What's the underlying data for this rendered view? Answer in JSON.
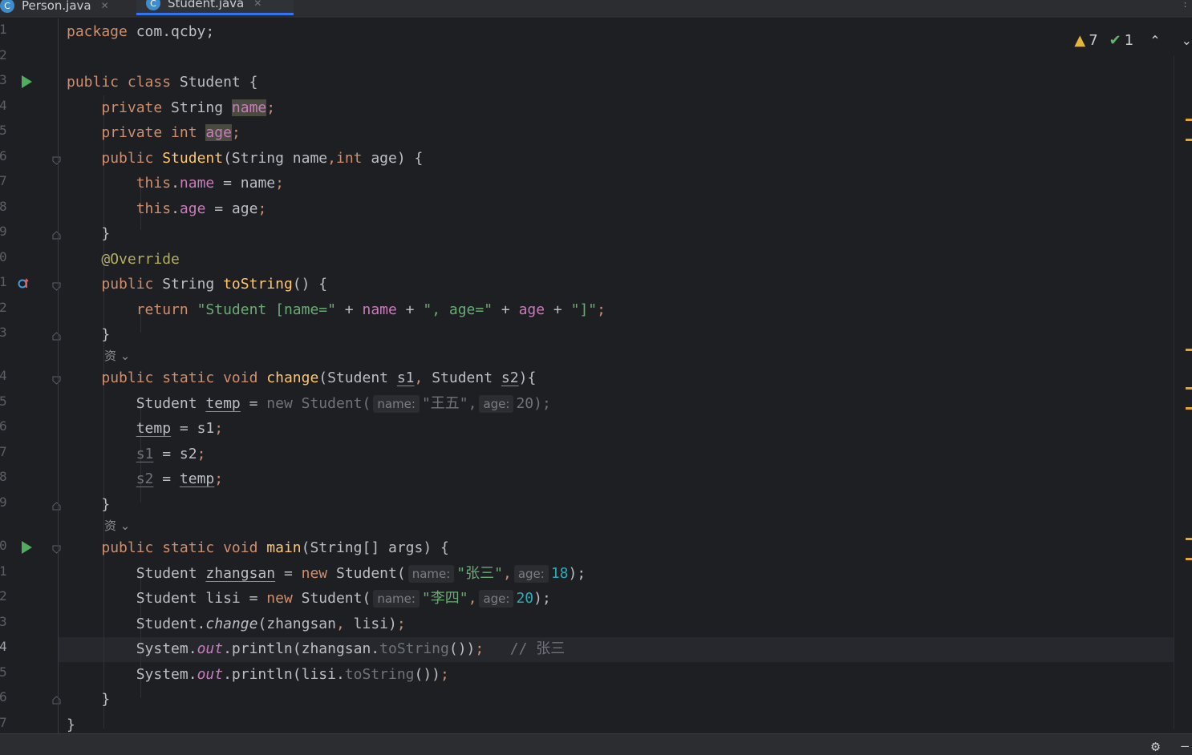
{
  "tabs": [
    {
      "label": "Person.java",
      "icon": "C"
    },
    {
      "label": "Student.java",
      "icon": "C"
    }
  ],
  "inspection": {
    "warnings": "7",
    "ok": "1"
  },
  "line_numbers": [
    "1",
    "2",
    "3",
    "4",
    "5",
    "6",
    "7",
    "8",
    "9",
    "0",
    "1",
    "2",
    "3",
    "4",
    "5",
    "6",
    "7",
    "8",
    "9",
    "0",
    "1",
    "2",
    "3",
    "4",
    "5",
    "6",
    "7"
  ],
  "code": {
    "l1_kw": "package",
    "l1_rest": " com.qcby;",
    "l3_kw": "public class",
    "l3_rest": " Student {",
    "l4_kw": "private",
    "l4_type": " String ",
    "l4_field": "name",
    "l4_end": ";",
    "l5_kw": "private int",
    "l5_sp": " ",
    "l5_field": "age",
    "l5_end": ";",
    "l6_kw": "public",
    "l6_name": " Student",
    "l6_a": "(String name",
    "l6_comma": ",",
    "l6_kw2": "int",
    "l6_b": " age) {",
    "l7_this": "this",
    "l7_dot": ".",
    "l7_field": "name",
    "l7_rest": " = name",
    "l7_end": ";",
    "l8_this": "this",
    "l8_dot": ".",
    "l8_field": "age",
    "l8_rest": " = age",
    "l8_end": ";",
    "l9": "}",
    "l10_ann": "@Override",
    "l11_kw": "public",
    "l11_type": " String ",
    "l11_name": "toString",
    "l11_rest": "() {",
    "l12_kw": "return",
    "l12_s1": "\"Student [name=\"",
    "l12_p1": " + ",
    "l12_f1": "name",
    "l12_p2": " + ",
    "l12_s2": "\", age=\"",
    "l12_p3": " + ",
    "l12_f2": "age",
    "l12_p4": " + ",
    "l12_s3": "\"]\"",
    "l12_end": ";",
    "l13": "}",
    "l14_kw": "public static void",
    "l14_name": " change",
    "l14_a": "(Student ",
    "l14_p1": "s1",
    "l14_comma": ",",
    "l14_b": " Student ",
    "l14_p2": "s2",
    "l14_c": "){",
    "l15_type": "Student ",
    "l15_var": "temp",
    "l15_eq": " = ",
    "l15_new": "new",
    "l15_cls": " Student(",
    "l15_h1": "name:",
    "l15_s": "\"王五\"",
    "l15_comma": ",",
    "l15_h2": "age:",
    "l15_n": "20",
    "l15_end": ");",
    "l16_var": "temp",
    "l16_rest": " = s1",
    "l16_end": ";",
    "l17_var": "s1",
    "l17_rest": " = s2",
    "l17_end": ";",
    "l18_var": "s2",
    "l18_eq": " = ",
    "l18_v2": "temp",
    "l18_end": ";",
    "l19": "}",
    "l20_kw": "public static void",
    "l20_name": " main",
    "l20_rest": "(String[] args) {",
    "l21_type": "Student ",
    "l21_var": "zhangsan",
    "l21_eq": " = ",
    "l21_new": "new",
    "l21_cls": " Student(",
    "l21_h1": "name:",
    "l21_s": "\"张三\"",
    "l21_comma": ",",
    "l21_h2": "age:",
    "l21_n": "18",
    "l21_end": ");",
    "l22_type": "Student lisi = ",
    "l22_new": "new",
    "l22_cls": " Student(",
    "l22_h1": "name:",
    "l22_s": "\"李四\"",
    "l22_comma": ",",
    "l22_h2": "age:",
    "l22_n": "20",
    "l22_end": ");",
    "l23_a": "Student.",
    "l23_m": "change",
    "l23_b": "(zhangsan",
    "l23_comma": ",",
    "l23_c": " lisi)",
    "l23_end": ";",
    "l24_a": "System.",
    "l24_out": "out",
    "l24_b": ".println(zhangsan.",
    "l24_m": "toString",
    "l24_c": "())",
    "l24_end": ";",
    "l24_cm": "// 张三",
    "l25_a": "System.",
    "l25_out": "out",
    "l25_b": ".println(lisi.",
    "l25_m": "toString",
    "l25_c": "())",
    "l25_end": ";",
    "l26": "}",
    "l27": "}"
  },
  "inlay_hint": "资",
  "inlay_arrow": "⌄",
  "icons": {
    "run": "run-gutter-icon",
    "override": "override-gutter-icon",
    "warning": "warning-icon",
    "check": "check-icon",
    "settings": "gear-icon"
  }
}
